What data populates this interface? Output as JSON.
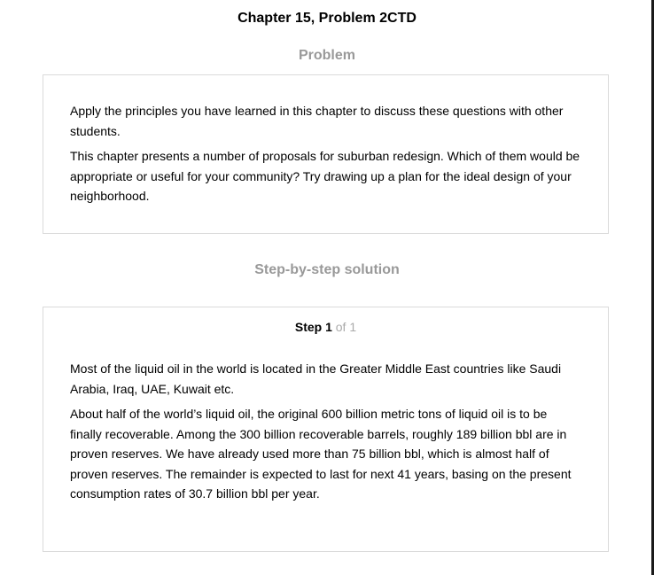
{
  "header": {
    "chapter_title": "Chapter 15, Problem 2CTD"
  },
  "problem": {
    "heading": "Problem",
    "paragraphs": [
      "Apply the principles you have learned in this chapter to discuss these questions with other students.",
      "This chapter presents a number of proposals for suburban redesign. Which of them would be appropriate or useful for your community? Try drawing up a plan for the ideal design of your neighborhood."
    ]
  },
  "solution": {
    "heading": "Step-by-step solution",
    "step_word": "Step 1",
    "step_of": "of 1",
    "paragraphs": [
      "Most of the liquid oil in the world is located in the Greater Middle East countries like Saudi Arabia, Iraq, UAE, Kuwait etc.",
      "About half of the world’s liquid oil, the original 600 billion metric tons of liquid oil is to be finally recoverable. Among the 300 billion recoverable barrels, roughly 189 billion bbl are in proven reserves. We have already used more than 75 billion bbl, which is almost half of proven reserves. The remainder is expected to last for next 41 years, basing on the present consumption rates of 30.7 billion bbl per year."
    ]
  }
}
